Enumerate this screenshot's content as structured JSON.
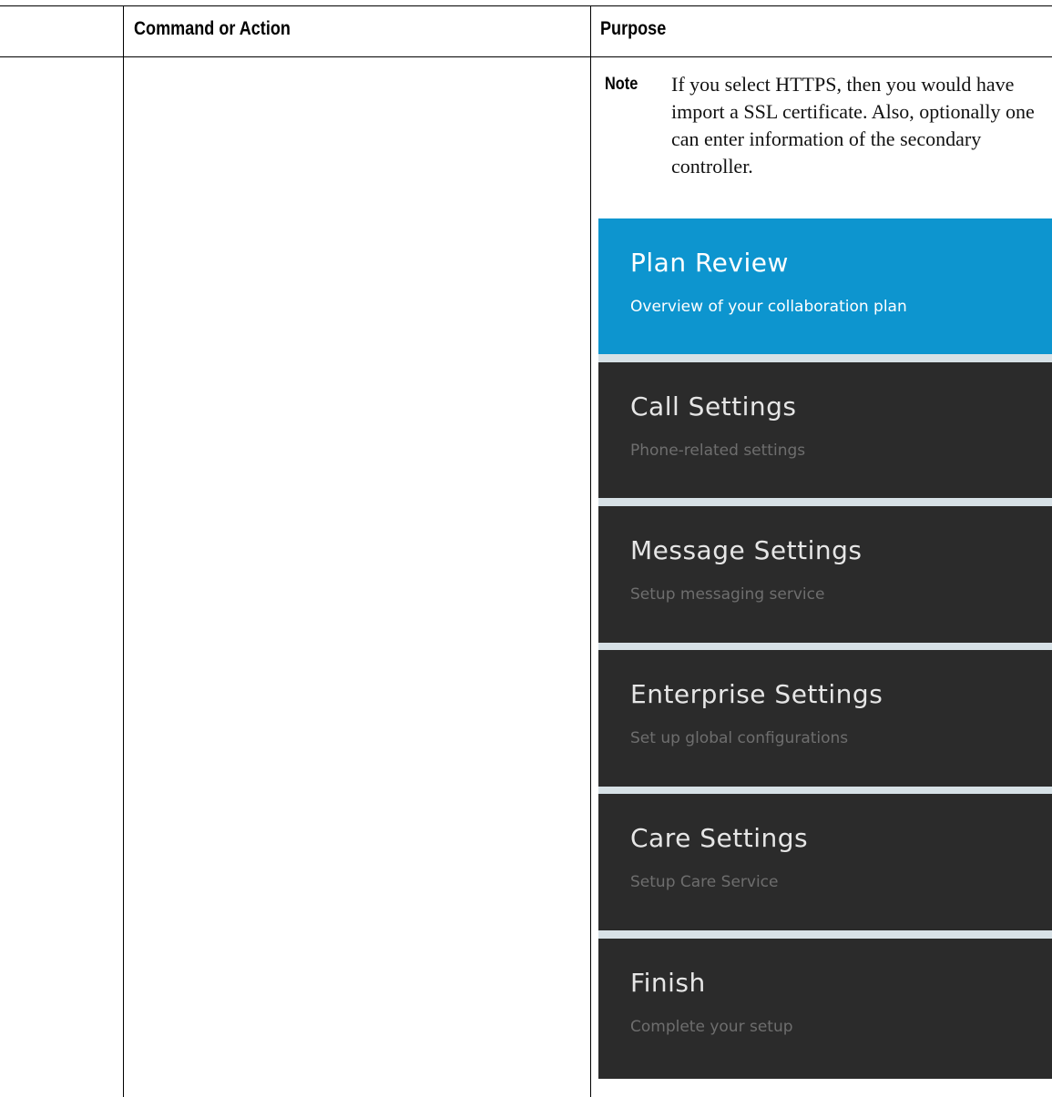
{
  "table": {
    "headers": {
      "col1": "",
      "col2": "Command or Action",
      "col3": "Purpose"
    }
  },
  "note": {
    "label": "Note",
    "text": "If you select HTTPS, then you would have import a SSL certificate. Also, optionally one can enter information of the secondary controller."
  },
  "wizard": {
    "active_index": 0,
    "steps": [
      {
        "title": "Plan Review",
        "subtitle": "Overview of your collaboration plan"
      },
      {
        "title": "Call Settings",
        "subtitle": "Phone-related settings"
      },
      {
        "title": "Message Settings",
        "subtitle": "Setup messaging service"
      },
      {
        "title": "Enterprise Settings",
        "subtitle": "Set up global configurations"
      },
      {
        "title": "Care Settings",
        "subtitle": "Setup Care Service"
      },
      {
        "title": "Finish",
        "subtitle": "Complete your setup"
      }
    ],
    "colors": {
      "active": "#0d95cf",
      "inactive": "#2b2b2b",
      "separator": "#d7e1e6"
    }
  }
}
